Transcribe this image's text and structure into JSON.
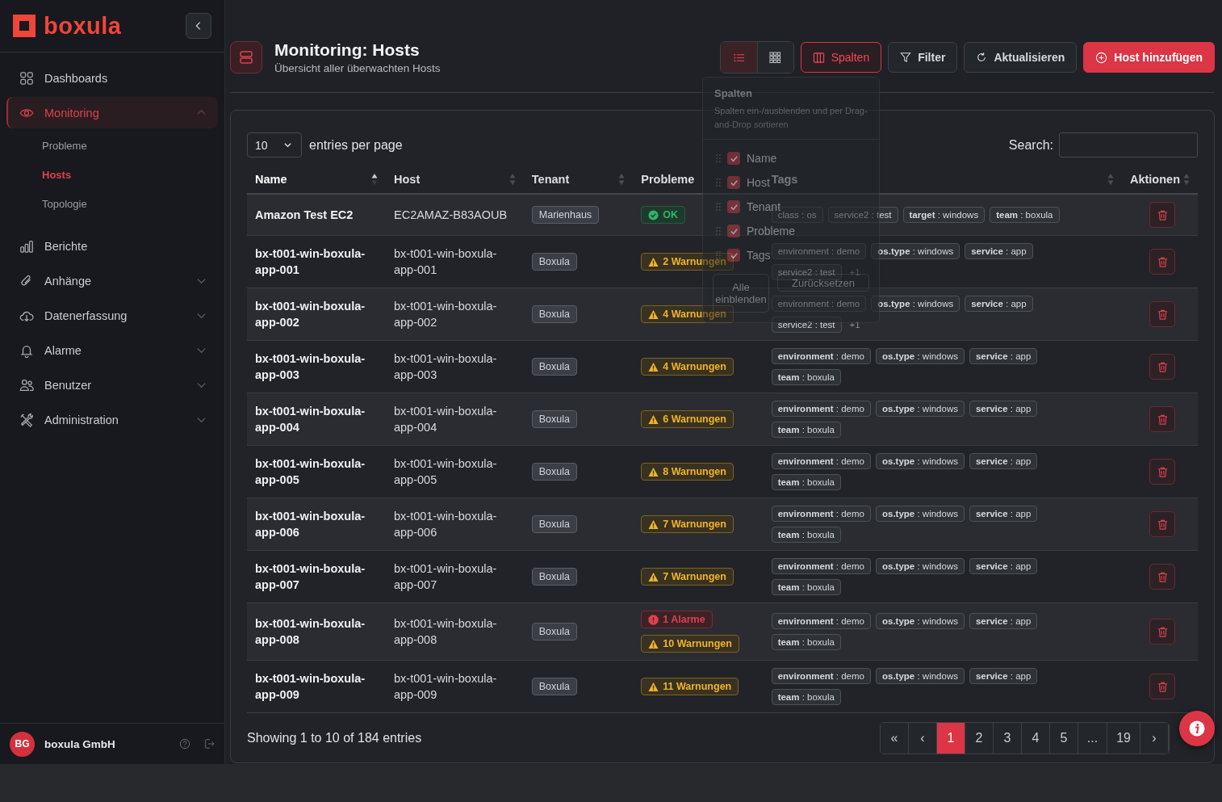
{
  "sidebar": {
    "logo": "boxula",
    "items": [
      {
        "kind": "link",
        "label": "Dashboards",
        "selected": false
      },
      {
        "kind": "group",
        "label": "Monitoring",
        "selected": true,
        "expanded": true,
        "children": [
          {
            "label": "Probleme",
            "selected": false
          },
          {
            "label": "Hosts",
            "selected": true
          },
          {
            "label": "Topologie",
            "selected": false
          }
        ]
      },
      {
        "kind": "link",
        "label": "Berichte",
        "selected": false
      },
      {
        "kind": "group",
        "label": "Anhänge",
        "selected": false,
        "expanded": false
      },
      {
        "kind": "group",
        "label": "Datenerfassung",
        "selected": false,
        "expanded": false
      },
      {
        "kind": "group",
        "label": "Alarme",
        "selected": false,
        "expanded": false
      },
      {
        "kind": "group",
        "label": "Benutzer",
        "selected": false,
        "expanded": false
      },
      {
        "kind": "group",
        "label": "Administration",
        "selected": false,
        "expanded": false
      }
    ],
    "user": {
      "initials": "BG",
      "name": "boxula GmbH"
    }
  },
  "header": {
    "title": "Monitoring: Hosts",
    "subtitle": "Übersicht aller überwachten Hosts"
  },
  "toolbar": {
    "views": [
      {
        "kind": "list",
        "selected": true
      },
      {
        "kind": "grid",
        "selected": false
      }
    ],
    "buttons": [
      {
        "kind": "columns",
        "label": "Spalten",
        "active": true
      },
      {
        "kind": "filter",
        "label": "Filter",
        "active": false
      },
      {
        "kind": "refresh",
        "label": "Aktualisieren",
        "active": false
      },
      {
        "kind": "add",
        "label": "Host hinzufügen",
        "active": false
      }
    ]
  },
  "columns_menu": {
    "title": "Spalten",
    "description": "Spalten ein-/ausblenden und per Drag-and-Drop sortieren",
    "items": [
      {
        "label": "Name",
        "checked": true
      },
      {
        "label": "Host",
        "checked": true
      },
      {
        "label": "Tenant",
        "checked": true
      },
      {
        "label": "Probleme",
        "checked": true
      },
      {
        "label": "Tags",
        "checked": true
      }
    ],
    "buttons": [
      "Alle einblenden",
      "Zurücksetzen"
    ]
  },
  "table": {
    "page_size": "10",
    "page_size_label": "entries per page",
    "search_label": "Search:",
    "columns": [
      {
        "label": "Name",
        "sortable": true,
        "sorted": true
      },
      {
        "label": "Host",
        "sortable": true,
        "sorted": false
      },
      {
        "label": "Tenant",
        "sortable": true,
        "sorted": false
      },
      {
        "label": "Probleme",
        "sortable": false,
        "sorted": false
      },
      {
        "label": "Tags",
        "sortable": true,
        "sorted": false
      },
      {
        "label": "Aktionen",
        "sortable": true,
        "sorted": false
      }
    ],
    "rows": [
      {
        "name": "Amazon Test EC2",
        "host": "EC2AMAZ-B83AOUB",
        "tenant": "Marienhaus",
        "problems": [
          {
            "kind": "ok",
            "text": "OK"
          }
        ],
        "tags": [
          "class : os",
          "service2 : test",
          "**target** : windows",
          "**team** : boxula"
        ]
      },
      {
        "name": "bx-t001-win-boxula-app-001",
        "host": "bx-t001-win-boxula-app-001",
        "tenant": "Boxula",
        "problems": [
          {
            "kind": "warning",
            "text": "2 Warnungen"
          }
        ],
        "tags": [
          "environment : demo",
          "**os.type** : windows",
          "**service** : app",
          "service2 : test"
        ],
        "more": "+1"
      },
      {
        "name": "bx-t001-win-boxula-app-002",
        "host": "bx-t001-win-boxula-app-002",
        "tenant": "Boxula",
        "problems": [
          {
            "kind": "warning",
            "text": "4 Warnungen"
          }
        ],
        "tags": [
          "environment : demo",
          "**os.type** : windows",
          "**service** : app",
          "service2 : test"
        ],
        "more": "+1"
      },
      {
        "name": "bx-t001-win-boxula-app-003",
        "host": "bx-t001-win-boxula-app-003",
        "tenant": "Boxula",
        "problems": [
          {
            "kind": "warning",
            "text": "4 Warnungen"
          }
        ],
        "tags": [
          "**environment** : demo",
          "**os.type** : windows",
          "**service** : app",
          "**team** : boxula"
        ]
      },
      {
        "name": "bx-t001-win-boxula-app-004",
        "host": "bx-t001-win-boxula-app-004",
        "tenant": "Boxula",
        "problems": [
          {
            "kind": "warning",
            "text": "6 Warnungen"
          }
        ],
        "tags": [
          "**environment** : demo",
          "**os.type** : windows",
          "**service** : app",
          "**team** : boxula"
        ]
      },
      {
        "name": "bx-t001-win-boxula-app-005",
        "host": "bx-t001-win-boxula-app-005",
        "tenant": "Boxula",
        "problems": [
          {
            "kind": "warning",
            "text": "8 Warnungen"
          }
        ],
        "tags": [
          "**environment** : demo",
          "**os.type** : windows",
          "**service** : app",
          "**team** : boxula"
        ]
      },
      {
        "name": "bx-t001-win-boxula-app-006",
        "host": "bx-t001-win-boxula-app-006",
        "tenant": "Boxula",
        "problems": [
          {
            "kind": "warning",
            "text": "7 Warnungen"
          }
        ],
        "tags": [
          "**environment** : demo",
          "**os.type** : windows",
          "**service** : app",
          "**team** : boxula"
        ]
      },
      {
        "name": "bx-t001-win-boxula-app-007",
        "host": "bx-t001-win-boxula-app-007",
        "tenant": "Boxula",
        "problems": [
          {
            "kind": "warning",
            "text": "7 Warnungen"
          }
        ],
        "tags": [
          "**environment** : demo",
          "**os.type** : windows",
          "**service** : app",
          "**team** : boxula"
        ]
      },
      {
        "name": "bx-t001-win-boxula-app-008",
        "host": "bx-t001-win-boxula-app-008",
        "tenant": "Boxula",
        "problems": [
          {
            "kind": "alarm",
            "text": "1 Alarme"
          },
          {
            "kind": "warning",
            "text": "10 Warnungen"
          }
        ],
        "tags": [
          "**environment** : demo",
          "**os.type** : windows",
          "**service** : app",
          "**team** : boxula"
        ]
      },
      {
        "name": "bx-t001-win-boxula-app-009",
        "host": "bx-t001-win-boxula-app-009",
        "tenant": "Boxula",
        "problems": [
          {
            "kind": "warning",
            "text": "11 Warnungen"
          }
        ],
        "tags": [
          "**environment** : demo",
          "**os.type** : windows",
          "**service** : app",
          "**team** : boxula"
        ]
      }
    ],
    "info": "Showing 1 to 10 of 184 entries",
    "pages": [
      {
        "label": "«",
        "selected": false
      },
      {
        "label": "‹",
        "selected": false
      },
      {
        "label": "1",
        "selected": true
      },
      {
        "label": "2",
        "selected": false
      },
      {
        "label": "3",
        "selected": false
      },
      {
        "label": "4",
        "selected": false
      },
      {
        "label": "5",
        "selected": false
      },
      {
        "label": "...",
        "selected": false
      },
      {
        "label": "19",
        "selected": false
      },
      {
        "label": "›",
        "selected": false
      }
    ]
  }
}
